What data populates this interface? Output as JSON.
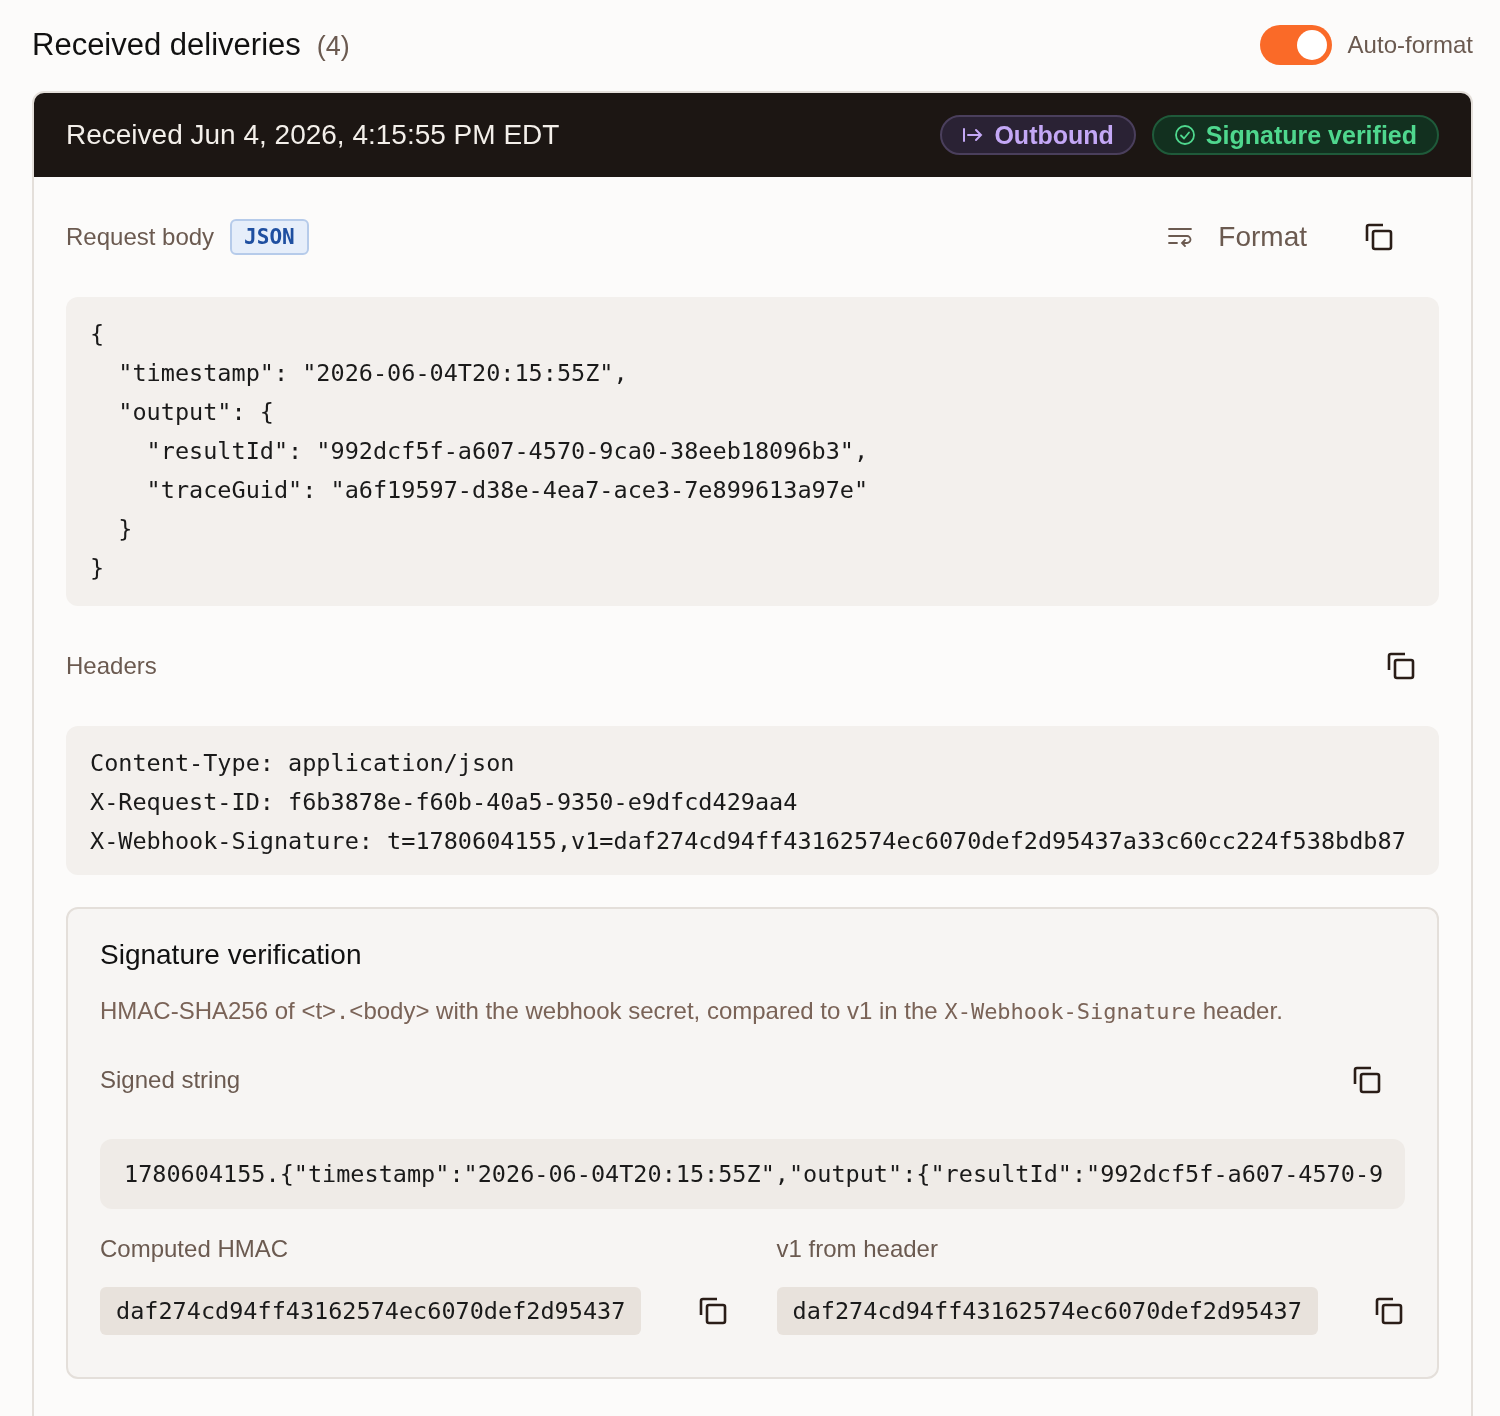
{
  "header": {
    "title": "Received deliveries",
    "count": "(4)",
    "auto_format": {
      "label": "Auto-format",
      "on": true
    }
  },
  "delivery": {
    "received": "Received Jun 4, 2026, 4:15:55 PM EDT",
    "badges": [
      {
        "kind": "direction",
        "label": "Outbound"
      },
      {
        "kind": "verified",
        "label": "Signature verified"
      }
    ],
    "request_body": {
      "label": "Request body",
      "type_badge": "JSON",
      "format_label": "Format",
      "lines": [
        "{",
        "  \"timestamp\": \"2026-06-04T20:15:55Z\",",
        "  \"output\": {",
        "    \"resultId\": \"992dcf5f-a607-4570-9ca0-38eeb18096b3\",",
        "    \"traceGuid\": \"a6f19597-d38e-4ea7-ace3-7e899613a97e\"",
        "  }",
        "}"
      ]
    },
    "headers": {
      "label": "Headers",
      "lines": [
        "Content-Type: application/json",
        "X-Request-ID: f6b3878e-f60b-40a5-9350-e9dfcd429aa4",
        "X-Webhook-Signature: t=1780604155,v1=daf274cd94ff43162574ec6070def2d95437a33c60cc224f538bdb87"
      ]
    },
    "verification": {
      "title": "Signature verification",
      "description": [
        {
          "code": false,
          "text": "HMAC-SHA256 of <t>"
        },
        {
          "code": true,
          "text": "."
        },
        {
          "code": false,
          "text": "<body> with the webhook secret, compared to v1 in the "
        },
        {
          "code": true,
          "text": "X-Webhook-Signature"
        },
        {
          "code": false,
          "text": " header."
        }
      ],
      "signed_string": {
        "label": "Signed string",
        "value": "1780604155.{\"timestamp\":\"2026-06-04T20:15:55Z\",\"output\":{\"resultId\":\"992dcf5f-a607-4570-9"
      },
      "computed": {
        "label": "Computed HMAC",
        "value": "daf274cd94ff43162574ec6070def2d95437"
      },
      "from_header": {
        "label": "v1 from header",
        "value": "daf274cd94ff43162574ec6070def2d95437"
      }
    }
  }
}
